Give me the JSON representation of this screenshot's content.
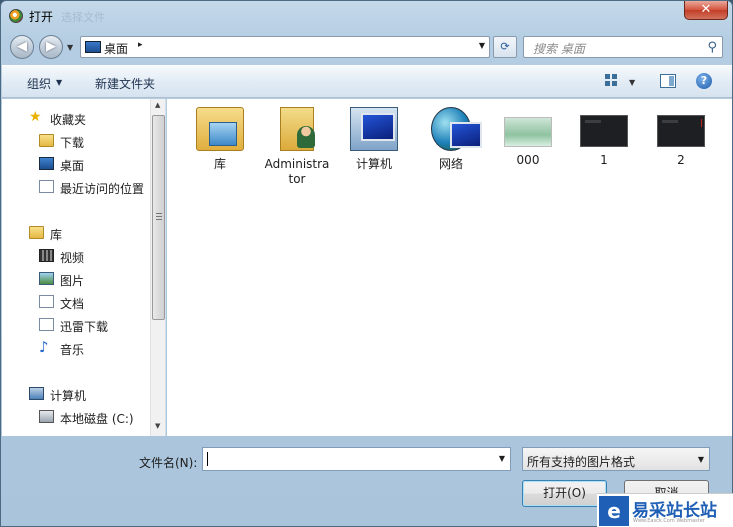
{
  "window": {
    "title": "打开",
    "title_ghost": "选择文件",
    "close_label": "✕"
  },
  "address_bar": {
    "location": "桌面",
    "separator": "▸",
    "refresh_label": "⟳",
    "search_placeholder": "搜索 桌面"
  },
  "toolbar": {
    "organize_label": "组织",
    "new_folder_label": "新建文件夹",
    "help_label": "?"
  },
  "sidebar": {
    "items": [
      {
        "label": "收藏夹",
        "icon": "star-icon",
        "level": 0
      },
      {
        "label": "下载",
        "icon": "download-folder-icon",
        "level": 1
      },
      {
        "label": "桌面",
        "icon": "desktop-icon",
        "level": 1
      },
      {
        "label": "最近访问的位置",
        "icon": "recent-places-icon",
        "level": 1
      },
      {
        "label": "库",
        "icon": "library-icon",
        "level": 0
      },
      {
        "label": "视频",
        "icon": "video-icon",
        "level": 1
      },
      {
        "label": "图片",
        "icon": "pictures-icon",
        "level": 1
      },
      {
        "label": "文档",
        "icon": "documents-icon",
        "level": 1
      },
      {
        "label": "迅雷下载",
        "icon": "thunder-download-icon",
        "level": 1
      },
      {
        "label": "音乐",
        "icon": "music-icon",
        "level": 1
      },
      {
        "label": "计算机",
        "icon": "computer-icon",
        "level": 0
      },
      {
        "label": "本地磁盘 (C:)",
        "icon": "disk-icon",
        "level": 1
      }
    ]
  },
  "files": [
    {
      "name": "库",
      "icon": "library-folder-icon"
    },
    {
      "name": "Administrator",
      "icon": "user-folder-icon"
    },
    {
      "name": "计算机",
      "icon": "computer-icon"
    },
    {
      "name": "网络",
      "icon": "network-icon"
    },
    {
      "name": "000",
      "icon": "image-thumbnail"
    },
    {
      "name": "1",
      "icon": "dark-image-thumbnail"
    },
    {
      "name": "2",
      "icon": "dark-image-thumbnail"
    }
  ],
  "bottom": {
    "filename_label": "文件名(N):",
    "filename_value": "",
    "filetype_value": "所有支持的图片格式",
    "open_label": "打开(O)",
    "cancel_label": "取消"
  },
  "watermark": {
    "title": "易采站长站",
    "subtitle": "Www.Easck.Com Webmaster"
  }
}
